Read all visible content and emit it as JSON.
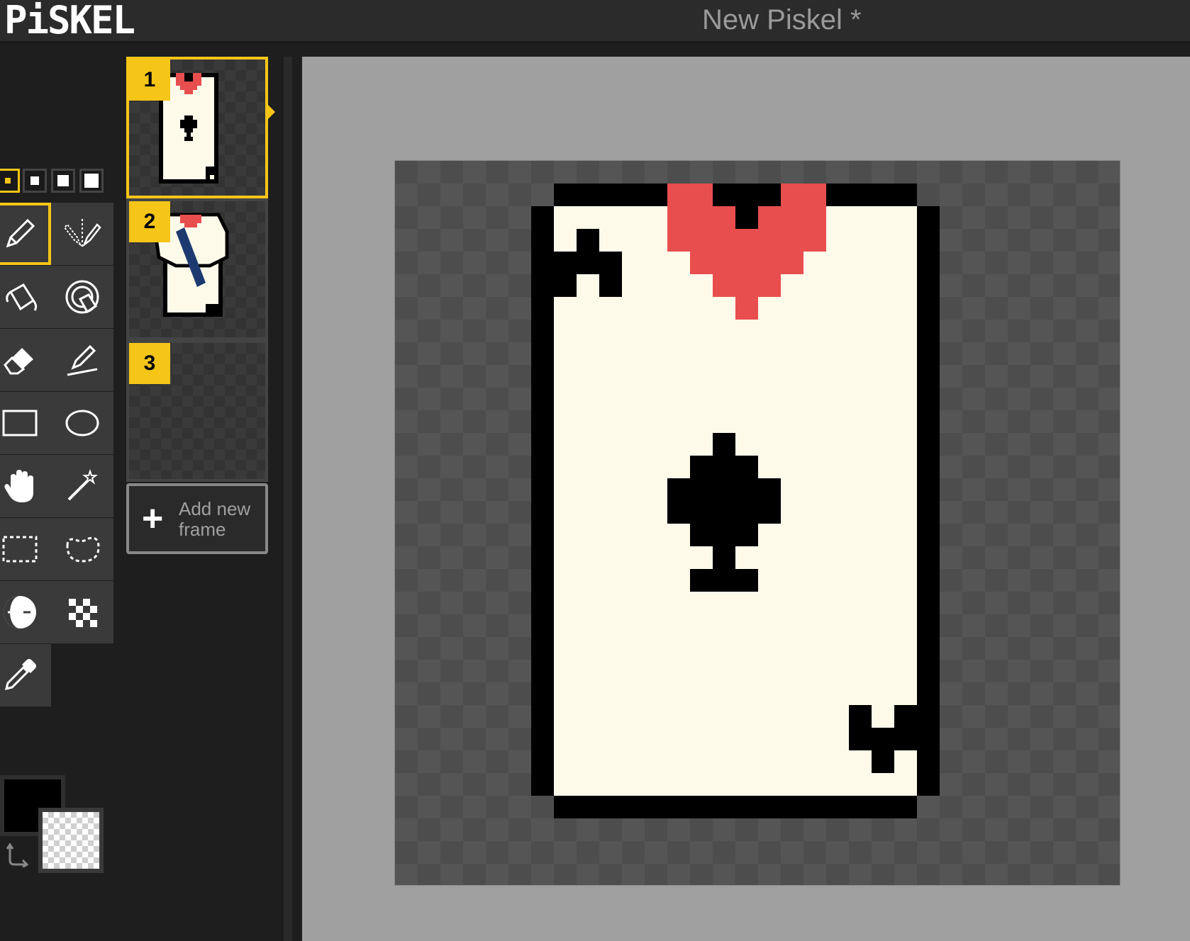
{
  "header": {
    "logo": "PiSKEL",
    "title": "New Piskel *"
  },
  "pen_sizes": [
    "1",
    "2",
    "3",
    "4"
  ],
  "tools": [
    {
      "name": "pen-icon"
    },
    {
      "name": "vertical-mirror-pen-icon"
    },
    {
      "name": "paint-bucket-icon"
    },
    {
      "name": "paint-all-same-color-icon"
    },
    {
      "name": "eraser-icon"
    },
    {
      "name": "stroke-icon"
    },
    {
      "name": "rectangle-icon"
    },
    {
      "name": "circle-icon"
    },
    {
      "name": "move-hand-icon"
    },
    {
      "name": "shape-selection-wand-icon"
    },
    {
      "name": "rectangle-selection-icon"
    },
    {
      "name": "lasso-selection-icon"
    },
    {
      "name": "lighten-darken-icon"
    },
    {
      "name": "dithering-icon"
    },
    {
      "name": "color-picker-icon"
    }
  ],
  "colors": {
    "primary": "#000000",
    "secondary": "transparent",
    "accent": "#f5c518",
    "card_face": "#fdfaea",
    "heart": "#e84e4e"
  },
  "frames": [
    {
      "number": "1"
    },
    {
      "number": "2"
    },
    {
      "number": "3"
    }
  ],
  "add_frame": {
    "plus": "+",
    "label": "Add new frame"
  }
}
